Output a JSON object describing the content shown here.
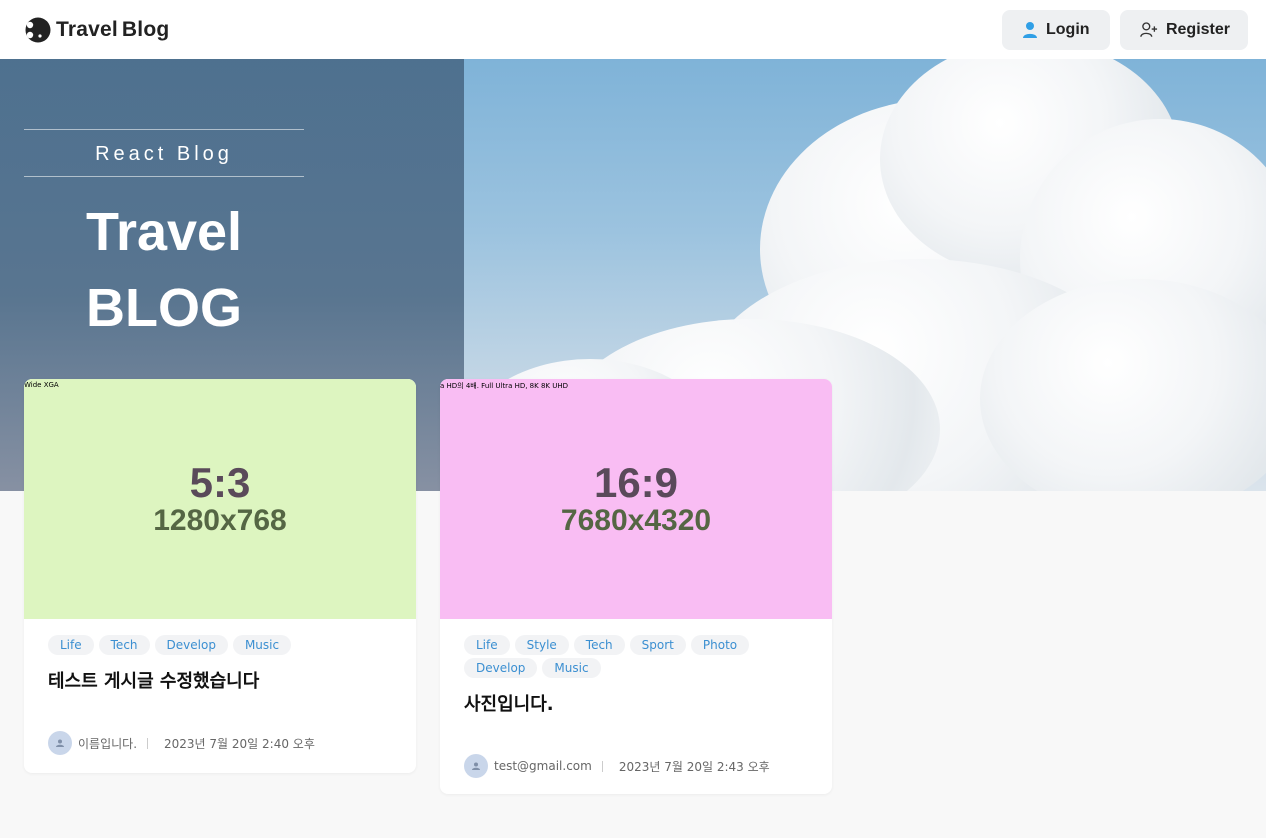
{
  "header": {
    "logo_word1": "Travel",
    "logo_word2": "Blog",
    "login_label": "Login",
    "register_label": "Register"
  },
  "hero": {
    "subtitle": "React Blog",
    "title_line1": "Travel",
    "title_line2": "BLOG"
  },
  "posts": [
    {
      "thumb_label": "Wide XGA",
      "thumb_ratio": "5:3",
      "thumb_resolution": "1280x768",
      "thumb_bg": "#ddf5c0",
      "tags": [
        "Life",
        "Tech",
        "Develop",
        "Music"
      ],
      "title": "테스트 게시글 수정했습니다",
      "author": "이름입니다.",
      "date": "2023년 7월 20일 2:40 오후"
    },
    {
      "thumb_label": "a HD의 4배. Full Ultra HD, 8K 8K UHD",
      "thumb_ratio": "16:9",
      "thumb_resolution": "7680x4320",
      "thumb_bg": "#f9bdf3",
      "tags": [
        "Life",
        "Style",
        "Tech",
        "Sport",
        "Photo",
        "Develop",
        "Music"
      ],
      "title": "사진입니다.",
      "author": "test@gmail.com",
      "date": "2023년 7월 20일 2:43 오후"
    }
  ],
  "colors": {
    "tag_text": "#3b8fd1",
    "ratio_text": "#5a4a5a",
    "resolution_text": "#556644"
  }
}
